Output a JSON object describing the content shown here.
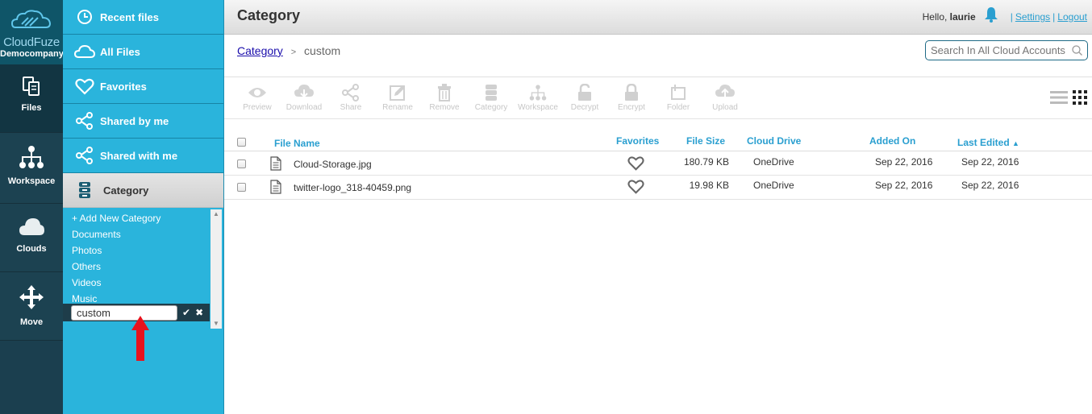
{
  "brand": {
    "name": "CloudFuze",
    "org": "Democompany"
  },
  "rail": [
    {
      "label": "Files",
      "icon": "files-icon"
    },
    {
      "label": "Workspace",
      "icon": "workspace-icon"
    },
    {
      "label": "Clouds",
      "icon": "cloud-icon"
    },
    {
      "label": "Move",
      "icon": "move-icon"
    }
  ],
  "sidebar": {
    "items": [
      {
        "label": "Recent files",
        "icon": "clock-icon"
      },
      {
        "label": "All Files",
        "icon": "cloud-outline-icon"
      },
      {
        "label": "Favorites",
        "icon": "heart-icon"
      },
      {
        "label": "Shared by me",
        "icon": "share-icon"
      },
      {
        "label": "Shared with me",
        "icon": "share-icon"
      },
      {
        "label": "Category",
        "icon": "category-icon"
      }
    ],
    "categories": [
      "+ Add New Category",
      "Documents",
      "Photos",
      "Others",
      "Videos",
      "Music"
    ],
    "new_category_value": "custom"
  },
  "header": {
    "title": "Category",
    "hello": "Hello,",
    "user": "laurie",
    "settings": "Settings",
    "logout": "Logout",
    "sep": "|"
  },
  "breadcrumb": {
    "root": "Category",
    "separator": ">",
    "current": "custom"
  },
  "search": {
    "placeholder": "Search In All Cloud Accounts"
  },
  "toolbar": [
    "Preview",
    "Download",
    "Share",
    "Rename",
    "Remove",
    "Category",
    "Workspace",
    "Decrypt",
    "Encrypt",
    "Folder",
    "Upload"
  ],
  "table": {
    "columns": {
      "name": "File Name",
      "fav": "Favorites",
      "size": "File Size",
      "drive": "Cloud Drive",
      "added": "Added On",
      "edited": "Last Edited",
      "sort_indicator": "▲"
    },
    "rows": [
      {
        "name": "Cloud-Storage.jpg",
        "size": "180.79 KB",
        "drive": "OneDrive",
        "added": "Sep 22, 2016",
        "edited": "Sep 22, 2016"
      },
      {
        "name": "twitter-logo_318-40459.png",
        "size": "19.98 KB",
        "drive": "OneDrive",
        "added": "Sep 22, 2016",
        "edited": "Sep 22, 2016"
      }
    ]
  },
  "colors": {
    "accent": "#2ab4dc",
    "rail": "#1b3f4f",
    "link": "#2a9fd0",
    "annotation": "#e8121d"
  }
}
